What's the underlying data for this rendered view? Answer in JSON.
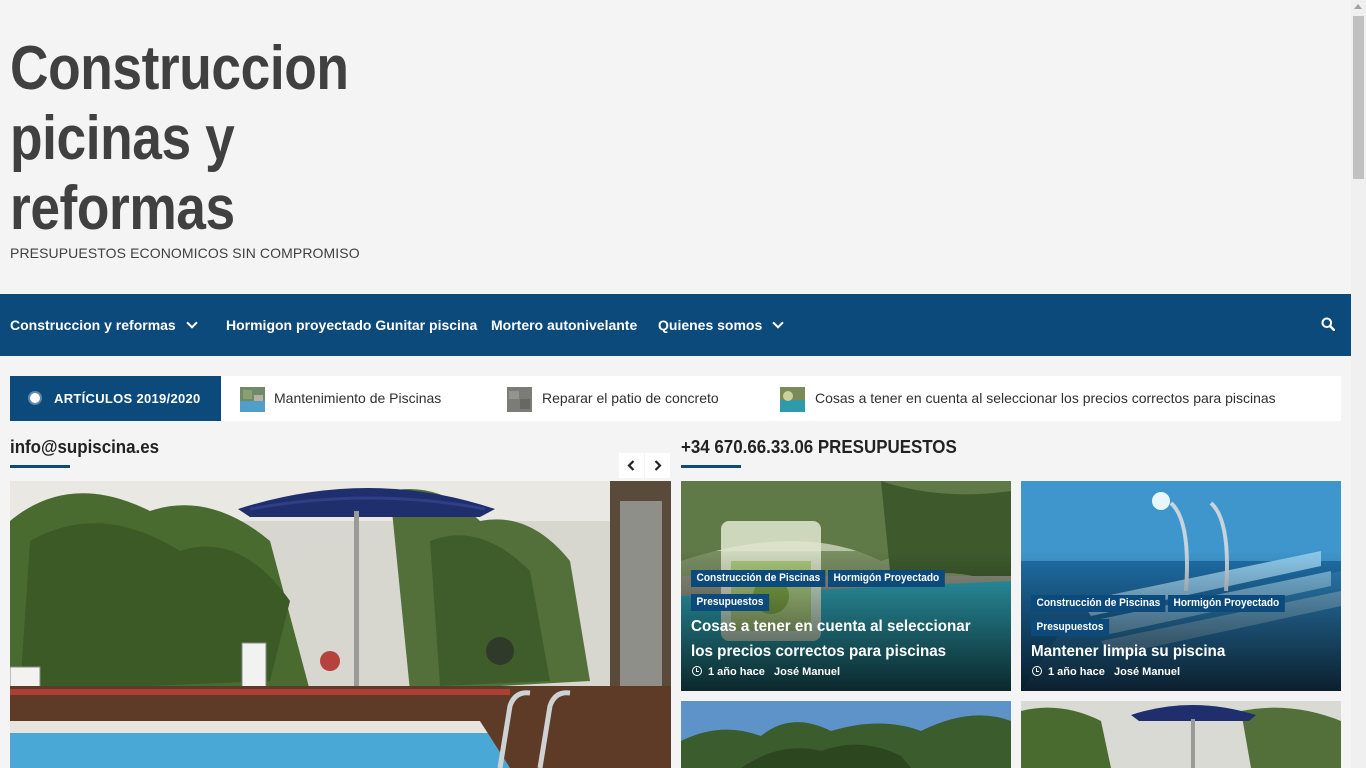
{
  "site": {
    "title": "Construccion picinas y reformas",
    "tagline": "PRESUPUESTOS ECONOMICOS SIN COMPROMISO"
  },
  "nav": {
    "items": [
      {
        "label": "Construccion y reformas",
        "has_submenu": true
      },
      {
        "label": "Hormigon proyectado Gunitar piscina",
        "has_submenu": false
      },
      {
        "label": "Mortero autonivelante",
        "has_submenu": false
      },
      {
        "label": "Quienes somos",
        "has_submenu": true
      }
    ],
    "search_icon": "search-icon",
    "background": "#0c4a7c"
  },
  "ticker": {
    "label": "ARTÍCULOS 2019/2020",
    "items": [
      {
        "text": "Mantenimiento de Piscinas"
      },
      {
        "text": "Reparar el patio de concreto"
      },
      {
        "text": "Cosas a tener en cuenta al seleccionar los precios correctos para piscinas"
      }
    ]
  },
  "left_section": {
    "title": "info@supiscina.es",
    "prev_icon": "chevron-left-icon",
    "next_icon": "chevron-right-icon"
  },
  "right_section": {
    "title": "+34 670.66.33.06 PRESUPUESTOS"
  },
  "cards": [
    {
      "tags": [
        "Construcción de Piscinas",
        "Hormigón Proyectado",
        "Presupuestos"
      ],
      "title": "Cosas a tener en cuenta al seleccionar los precios correctos para piscinas",
      "time": "1 año hace",
      "author": "José Manuel"
    },
    {
      "tags": [
        "Construcción de Piscinas",
        "Hormigón Proyectado",
        "Presupuestos"
      ],
      "title": "Mantener limpia su piscina",
      "time": "1 año hace",
      "author": "José Manuel"
    }
  ],
  "colors": {
    "accent": "#0c4a7c",
    "page_bg": "#f4f4f4",
    "text": "#404040"
  }
}
